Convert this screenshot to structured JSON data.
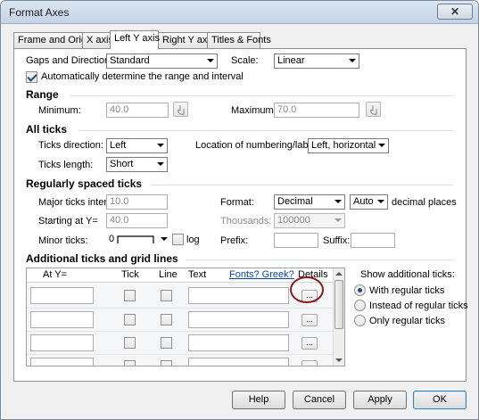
{
  "window": {
    "title": "Format Axes",
    "close_glyph": "✕"
  },
  "tabs": [
    {
      "label": "Frame and Origin"
    },
    {
      "label": "X axis"
    },
    {
      "label": "Left Y axis"
    },
    {
      "label": "Right Y axis"
    },
    {
      "label": "Titles & Fonts"
    }
  ],
  "top": {
    "gaps_label": "Gaps and Direction:",
    "gaps_value": "Standard",
    "scale_label": "Scale:",
    "scale_value": "Linear",
    "auto_checkbox_label": "Automatically determine the range and interval",
    "auto_checked": true
  },
  "range": {
    "heading": "Range",
    "min_label": "Minimum:",
    "min_value": "40.0",
    "max_label": "Maximum:",
    "max_value": "70.0",
    "icon": "hand-icon"
  },
  "all_ticks": {
    "heading": "All ticks",
    "direction_label": "Ticks direction:",
    "direction_value": "Left",
    "location_label": "Location of numbering/labeling:",
    "location_value": "Left, horizontal",
    "length_label": "Ticks length:",
    "length_value": "Short"
  },
  "regular": {
    "heading": "Regularly spaced ticks",
    "major_label": "Major ticks interval:",
    "major_value": "10.0",
    "format_label": "Format:",
    "format_value": "Decimal",
    "decimals_value": "Auto",
    "decimals_suffix": "decimal places",
    "starting_label": "Starting at Y=",
    "starting_value": "40.0",
    "thousands_label": "Thousands:",
    "thousands_value": "100000",
    "minor_label": "Minor ticks:",
    "minor_value": "0",
    "log_label": "log",
    "prefix_label": "Prefix:",
    "suffix_label": "Suffix:"
  },
  "additional": {
    "heading": "Additional ticks and grid lines",
    "columns": {
      "at_y": "At Y=",
      "tick": "Tick",
      "line": "Line",
      "text": "Text",
      "fonts_link": "Fonts? Greek?",
      "details": "Details"
    },
    "details_button": "...",
    "show_label": "Show additional ticks:",
    "options": [
      {
        "label": "With regular ticks",
        "selected": true
      },
      {
        "label": "Instead of regular ticks",
        "selected": false
      },
      {
        "label": "Only regular ticks",
        "selected": false
      }
    ]
  },
  "buttons": {
    "help": "Help",
    "cancel": "Cancel",
    "apply": "Apply",
    "ok": "OK"
  }
}
